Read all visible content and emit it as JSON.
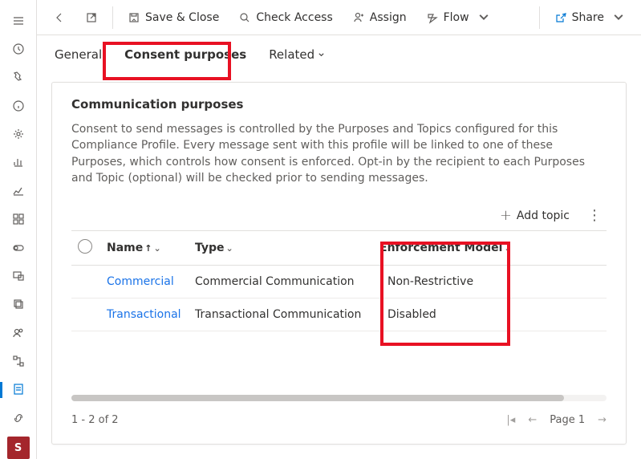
{
  "rail_app_letter": "S",
  "cmdbar": {
    "save_close": "Save & Close",
    "check_access": "Check Access",
    "assign": "Assign",
    "flow": "Flow",
    "share": "Share"
  },
  "tabs": {
    "general": "General",
    "consent_purposes": "Consent purposes",
    "related": "Related"
  },
  "card": {
    "title": "Communication purposes",
    "desc": "Consent to send messages is controlled by the Purposes and Topics configured for this Compliance Profile. Every message sent with this profile will be linked to one of these Purposes, which controls how consent is enforced. Opt-in by the recipient to each Purposes and Topic (optional) will be checked prior to sending messages.",
    "add_topic": "Add topic"
  },
  "columns": {
    "name": "Name",
    "type": "Type",
    "enforcement": "Enforcement Model"
  },
  "rows": [
    {
      "name": "Commercial",
      "type": "Commercial Communication",
      "enforcement": "Non-Restrictive"
    },
    {
      "name": "Transactional",
      "type": "Transactional Communication",
      "enforcement": "Disabled"
    }
  ],
  "pager": {
    "status": "1 - 2 of 2",
    "page_label": "Page 1"
  }
}
